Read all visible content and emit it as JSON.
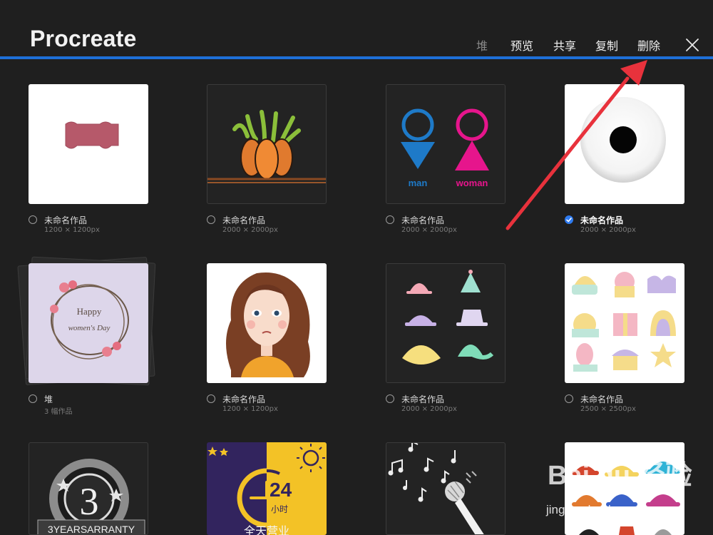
{
  "header": {
    "title": "Procreate",
    "actions": [
      "堆",
      "预览",
      "共享",
      "复制",
      "删除"
    ]
  },
  "artworks": [
    {
      "name": "未命名作品",
      "size": "1200 × 1200px",
      "selected": false
    },
    {
      "name": "未命名作品",
      "size": "2000 × 2000px",
      "selected": false
    },
    {
      "name": "未命名作品",
      "size": "2000 × 2000px",
      "selected": false,
      "thumb_text": [
        "man",
        "woman"
      ]
    },
    {
      "name": "未命名作品",
      "size": "2000 × 2000px",
      "selected": true
    },
    {
      "name": "堆",
      "size": "3 幅作品",
      "selected": false,
      "thumb_text": [
        "Happy",
        "women's Day"
      ]
    },
    {
      "name": "未命名作品",
      "size": "1200 × 1200px",
      "selected": false
    },
    {
      "name": "未命名作品",
      "size": "2000 × 2000px",
      "selected": false
    },
    {
      "name": "未命名作品",
      "size": "2500 × 2500px",
      "selected": false
    },
    {
      "name": "",
      "size": "",
      "selected": false,
      "thumb_text": [
        "3",
        "3YEARSARRANTY"
      ]
    },
    {
      "name": "",
      "size": "",
      "selected": false,
      "thumb_text": [
        "24",
        "小时",
        "全天营业"
      ]
    },
    {
      "name": "",
      "size": "",
      "selected": false
    },
    {
      "name": "",
      "size": "",
      "selected": false
    }
  ],
  "watermark": {
    "logo": "Bai du 经验",
    "url": "jingyan.baidu.com"
  },
  "colors": {
    "accent_blue": "#1e6fd8",
    "annotation_arrow": "#e8323c",
    "background": "#1f1f1f"
  }
}
